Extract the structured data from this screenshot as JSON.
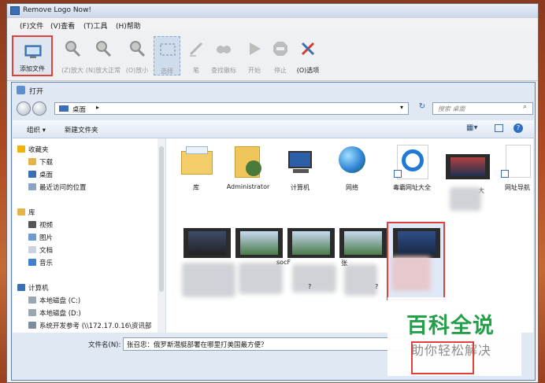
{
  "app": {
    "title": "Remove Logo Now!",
    "menu": [
      "(F)文件",
      "(V)查看",
      "(T)工具",
      "(H)帮助"
    ],
    "toolbar": [
      {
        "label": "添加文件",
        "icon": "add-file-icon",
        "enabled": true
      },
      {
        "label": "(Z)放大",
        "icon": "zoom-in-icon",
        "enabled": false
      },
      {
        "label": "(N)放大正常",
        "icon": "zoom-normal-icon",
        "enabled": false
      },
      {
        "label": "(O)放小",
        "icon": "zoom-out-icon",
        "enabled": false
      },
      {
        "label": "选择",
        "icon": "select-icon",
        "enabled": false
      },
      {
        "label": "笔",
        "icon": "pen-icon",
        "enabled": false
      },
      {
        "label": "查找徽标",
        "icon": "find-logo-icon",
        "enabled": false
      },
      {
        "label": "开始",
        "icon": "play-icon",
        "enabled": false
      },
      {
        "label": "停止",
        "icon": "stop-icon",
        "enabled": false
      },
      {
        "label": "(O)选项",
        "icon": "options-icon",
        "enabled": true
      }
    ]
  },
  "dialog": {
    "title": "打开",
    "address": "桌面",
    "search_placeholder": "搜索 桌面",
    "commands": {
      "organize": "组织 ▾",
      "new_folder": "新建文件夹"
    },
    "nav": {
      "favorites": "收藏夹",
      "favorites_items": [
        "下载",
        "桌面",
        "最近访问的位置"
      ],
      "libraries": "库",
      "library_items": [
        "视频",
        "图片",
        "文档",
        "音乐"
      ],
      "computer": "计算机",
      "computer_items": [
        "本地磁盘 (C:)",
        "本地磁盘 (D:)",
        "系统开发参考 (\\\\172.17.0.16\\资讯部"
      ]
    },
    "files_row1": [
      "库",
      "Administrator",
      "计算机",
      "网络",
      "毒霸网址大全",
      "",
      "网址导航"
    ],
    "partial_labels": {
      "r1_thumb": "大",
      "r2_a": "socF",
      "r2_b": "张",
      "r2_c": "?",
      "r2_d": "?"
    },
    "filename_label": "文件名(N):",
    "filename_value": "张召忠：俄罗斯潜艇部署在哪里打美国最方便？"
  },
  "watermark": {
    "title": "百科全说",
    "subtitle": "助你轻松解决"
  },
  "colors": {
    "highlight": "#e0403a",
    "watermark_green": "#25a04a"
  }
}
